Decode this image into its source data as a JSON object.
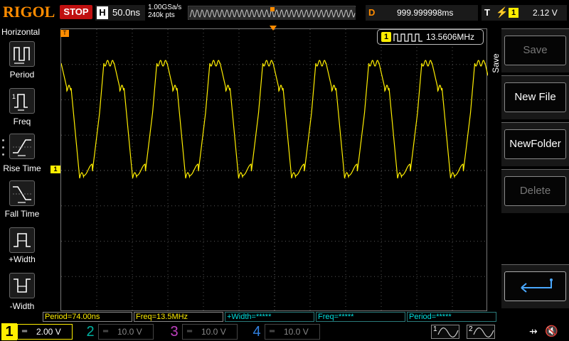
{
  "top": {
    "brand": "RIGOL",
    "run_state": "STOP",
    "h_label": "H",
    "timebase": "50.0ns",
    "sample_rate": "1.00GSa/s",
    "mem_depth": "240k pts",
    "delay_label": "D",
    "delay": "999.999998ms",
    "trig_label": "T",
    "trig_source": "1",
    "trig_level": "2.12 V"
  },
  "left_menu": {
    "title": "Horizontal",
    "items": [
      {
        "label": "Period",
        "icon": "period-icon"
      },
      {
        "label": "Freq",
        "icon": "freq-icon"
      },
      {
        "label": "Rise Time",
        "icon": "rise-time-icon"
      },
      {
        "label": "Fall Time",
        "icon": "fall-time-icon"
      },
      {
        "label": "+Width",
        "icon": "pos-width-icon"
      },
      {
        "label": "-Width",
        "icon": "neg-width-icon"
      }
    ]
  },
  "freq_counter": {
    "channel": "1",
    "value": "13.5606MHz"
  },
  "right_menu": {
    "title": "Save",
    "items": [
      {
        "label": "Save",
        "enabled": false
      },
      {
        "label": "New File",
        "enabled": true
      },
      {
        "label": "NewFolder",
        "enabled": true
      },
      {
        "label": "Delete",
        "enabled": false
      },
      {
        "label": "",
        "enabled": true
      }
    ]
  },
  "measurements": [
    {
      "text": "Period=74.00ns",
      "color": "#ffee00"
    },
    {
      "text": "Freq=13.5MHz",
      "color": "#ffee00"
    },
    {
      "text": "+Width=*****",
      "color": "#00e0e0"
    },
    {
      "text": "Freq=*****",
      "color": "#00e0e0"
    },
    {
      "text": "Period=*****",
      "color": "#00e0e0"
    }
  ],
  "channels": [
    {
      "num": "1",
      "scale": "2.00 V",
      "color": "#ffee00",
      "active": true
    },
    {
      "num": "2",
      "scale": "10.0 V",
      "color": "#00b0a0",
      "active": false
    },
    {
      "num": "3",
      "scale": "10.0 V",
      "color": "#c040c0",
      "active": false
    },
    {
      "num": "4",
      "scale": "10.0 V",
      "color": "#3080e0",
      "active": false
    }
  ],
  "generators": [
    {
      "num": "1"
    },
    {
      "num": "2"
    }
  ],
  "colors": {
    "ch1": "#ffee00",
    "brand": "#ff8c00",
    "trigger_marker": "#ff8c00",
    "stop": "#c01010"
  }
}
